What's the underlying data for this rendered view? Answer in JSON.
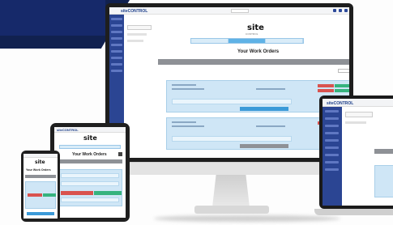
{
  "app": {
    "logo_text": "siteCONTROL",
    "brand": "site",
    "brand_subtitle": "CONTROL"
  },
  "page": {
    "title": "Your Work Orders"
  },
  "colors": {
    "sidebar": "#2b4593",
    "accent_blue": "#3b9ad8",
    "danger": "#d9534f",
    "success": "#36b37e",
    "card_bg": "#cfe6f6",
    "navy_bg": "#11214f"
  },
  "icons": [
    "user-menu-icon",
    "notifications-icon",
    "settings-icon",
    "logout-icon",
    "add-icon"
  ]
}
